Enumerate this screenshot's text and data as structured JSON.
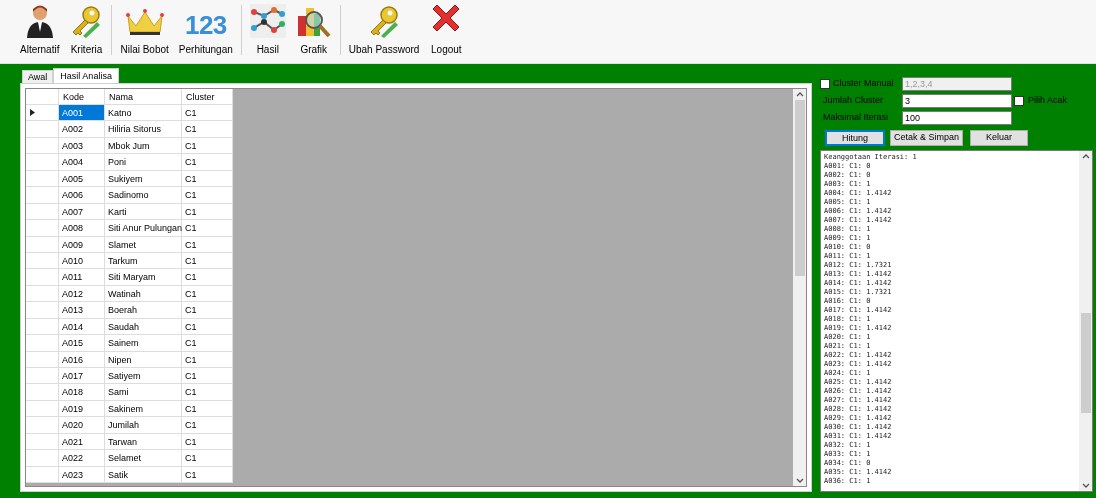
{
  "toolbar": [
    {
      "label": "Alternatif",
      "kind": "person"
    },
    {
      "label": "Kriteria",
      "kind": "key"
    },
    {
      "kind": "separator"
    },
    {
      "label": "Nilai Bobot",
      "kind": "crown"
    },
    {
      "label": "Perhitungan",
      "kind": "numbers",
      "glyph": "123"
    },
    {
      "kind": "separator"
    },
    {
      "label": "Hasil",
      "kind": "network"
    },
    {
      "label": "Grafik",
      "kind": "chart"
    },
    {
      "kind": "separator"
    },
    {
      "label": "Ubah Password",
      "kind": "key"
    },
    {
      "label": "Logout",
      "kind": "cross"
    }
  ],
  "tabs": [
    {
      "label": "Awal",
      "selected": false
    },
    {
      "label": "Hasil Analisa",
      "selected": true
    }
  ],
  "grid": {
    "columns": [
      "Kode",
      "Nama",
      "Cluster"
    ],
    "rows": [
      {
        "kode": "A001",
        "nama": "Katno",
        "cluster": "C1",
        "selected": true
      },
      {
        "kode": "A002",
        "nama": "Hiliria Sitorus",
        "cluster": "C1",
        "selected": false
      },
      {
        "kode": "A003",
        "nama": "Mbok Jum",
        "cluster": "C1",
        "selected": false
      },
      {
        "kode": "A004",
        "nama": "Poni",
        "cluster": "C1",
        "selected": false
      },
      {
        "kode": "A005",
        "nama": "Sukiyem",
        "cluster": "C1",
        "selected": false
      },
      {
        "kode": "A006",
        "nama": "Sadinomo",
        "cluster": "C1",
        "selected": false
      },
      {
        "kode": "A007",
        "nama": "Karti",
        "cluster": "C1",
        "selected": false
      },
      {
        "kode": "A008",
        "nama": "Siti Anur Pulungan",
        "cluster": "C1",
        "selected": false
      },
      {
        "kode": "A009",
        "nama": "Slamet",
        "cluster": "C1",
        "selected": false
      },
      {
        "kode": "A010",
        "nama": "Tarkum",
        "cluster": "C1",
        "selected": false
      },
      {
        "kode": "A011",
        "nama": "Siti Maryam",
        "cluster": "C1",
        "selected": false
      },
      {
        "kode": "A012",
        "nama": "Watinah",
        "cluster": "C1",
        "selected": false
      },
      {
        "kode": "A013",
        "nama": "Boerah",
        "cluster": "C1",
        "selected": false
      },
      {
        "kode": "A014",
        "nama": "Saudah",
        "cluster": "C1",
        "selected": false
      },
      {
        "kode": "A015",
        "nama": "Sainem",
        "cluster": "C1",
        "selected": false
      },
      {
        "kode": "A016",
        "nama": "Nipen",
        "cluster": "C1",
        "selected": false
      },
      {
        "kode": "A017",
        "nama": "Satiyem",
        "cluster": "C1",
        "selected": false
      },
      {
        "kode": "A018",
        "nama": "Sami",
        "cluster": "C1",
        "selected": false
      },
      {
        "kode": "A019",
        "nama": "Sakinem",
        "cluster": "C1",
        "selected": false
      },
      {
        "kode": "A020",
        "nama": "Jumilah",
        "cluster": "C1",
        "selected": false
      },
      {
        "kode": "A021",
        "nama": "Tarwan",
        "cluster": "C1",
        "selected": false
      },
      {
        "kode": "A022",
        "nama": "Selamet",
        "cluster": "C1",
        "selected": false
      },
      {
        "kode": "A023",
        "nama": "Satik",
        "cluster": "C1",
        "selected": false
      }
    ]
  },
  "settings": {
    "cluster_manual": {
      "label": "Cluster Manual",
      "checked": false,
      "value": "1,2,3,4",
      "disabled": true
    },
    "jumlah_cluster": {
      "label": "Jumlah Cluster",
      "value": "3"
    },
    "pilih_acak": {
      "label": "Pilih Acak",
      "checked": false
    },
    "maksimal_iterasi": {
      "label": "Maksimal Iterasi",
      "value": "100"
    }
  },
  "buttons": [
    {
      "label": "Hitung",
      "focused": true
    },
    {
      "label": "Cetak & Simpan",
      "focused": false
    },
    {
      "label": "Keluar",
      "focused": false
    }
  ],
  "output_lines": [
    "Keanggotaan Iterasi: 1",
    "A001: C1: 0",
    "A002: C1: 0",
    "A003: C1: 1",
    "A004: C1: 1.4142",
    "A005: C1: 1",
    "A006: C1: 1.4142",
    "A007: C1: 1.4142",
    "A008: C1: 1",
    "A009: C1: 1",
    "A010: C1: 0",
    "A011: C1: 1",
    "A012: C1: 1.7321",
    "A013: C1: 1.4142",
    "A014: C1: 1.4142",
    "A015: C1: 1.7321",
    "A016: C1: 0",
    "A017: C1: 1.4142",
    "A018: C1: 1",
    "A019: C1: 1.4142",
    "A020: C1: 1",
    "A021: C1: 1",
    "A022: C1: 1.4142",
    "A023: C1: 1.4142",
    "A024: C1: 1",
    "A025: C1: 1.4142",
    "A026: C1: 1.4142",
    "A027: C1: 1.4142",
    "A028: C1: 1.4142",
    "A029: C1: 1.4142",
    "A030: C1: 1.4142",
    "A031: C1: 1.4142",
    "A032: C1: 1",
    "A033: C1: 1",
    "A034: C1: 0",
    "A035: C1: 1.4142",
    "A036: C1: 1"
  ]
}
